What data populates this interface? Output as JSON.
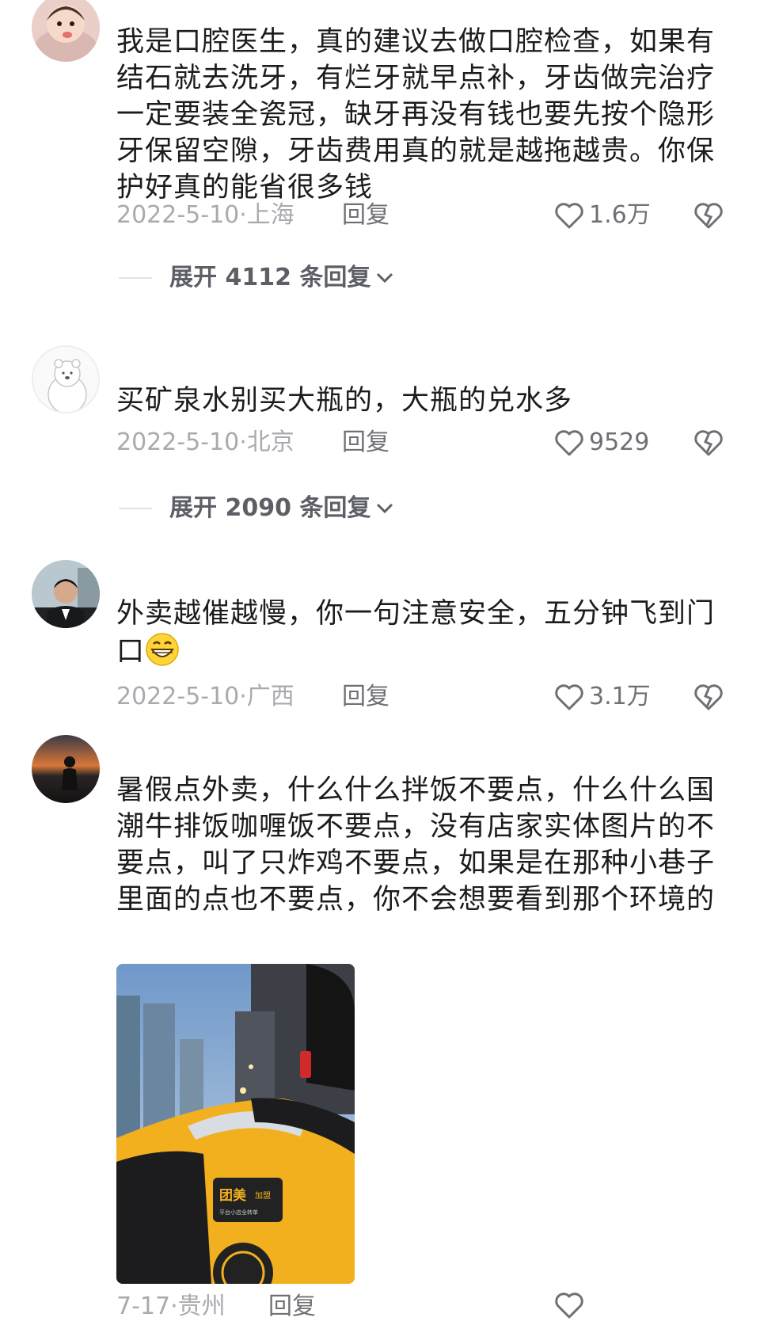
{
  "comments": [
    {
      "text": "我是口腔医生，真的建议去做口腔检查，如果有结石就去洗牙，有烂牙就早点补，牙齿做完治疗一定要装全瓷冠，缺牙再没有钱也要先按个隐形牙保留空隙，牙齿费用真的就是越拖越贵。你保护好真的能省很多钱",
      "date": "2022-5-10·上海",
      "reply_label": "回复",
      "likes": "1.6万",
      "expand_label": "展开 4112 条回复"
    },
    {
      "text": "买矿泉水别买大瓶的，大瓶的兑水多",
      "date": "2022-5-10·北京",
      "reply_label": "回复",
      "likes": "9529",
      "expand_label": "展开 2090 条回复"
    },
    {
      "text": "外卖越催越慢，你一句注意安全，五分钟飞到门口",
      "date": "2022-5-10·广西",
      "reply_label": "回复",
      "likes": "3.1万",
      "emoji": "grinning-face-emoji"
    },
    {
      "text": "暑假点外卖，什么什么拌饭不要点，什么什么国潮牛排饭咖喱饭不要点，没有店家实体图片的不要点，叫了只炸鸡不要点，如果是在那种小巷子里面的点也不要点，你不会想要看到那个环境的",
      "date": "7-17·贵州",
      "reply_label": "回复",
      "photo": {
        "badge_brand": "团美",
        "badge_tag": "加盟",
        "badge_sub": "平台小店全转单",
        "colors": {
          "jacket": "#f2b01e",
          "sky": "#8fb2d8"
        }
      }
    }
  ],
  "icons": {
    "like": "heart-outline-icon",
    "dislike": "broken-heart-icon",
    "expand": "chevron-down-icon"
  },
  "colors": {
    "meta": "#a9aaae",
    "action": "#6f7075",
    "text": "#1c1c1c"
  }
}
